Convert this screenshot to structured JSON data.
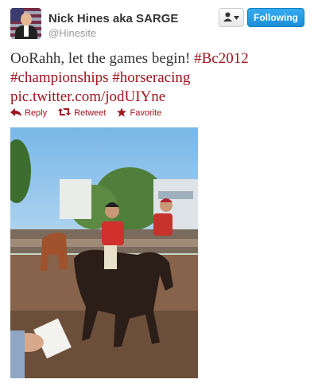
{
  "user": {
    "display_name": "Nick Hines aka SARGE",
    "handle": "@Hinesite"
  },
  "buttons": {
    "follow_label": "Following",
    "user_menu_icon": "user-dropdown-icon"
  },
  "tweet": {
    "text_parts": [
      "OoRahh, let the games begin! ",
      "#Bc2012",
      " ",
      "#championships",
      " ",
      "#horseracing",
      " ",
      "pic.twitter.com/jodUIYne"
    ]
  },
  "actions": {
    "reply": "Reply",
    "retweet": "Retweet",
    "favorite": "Favorite"
  },
  "colors": {
    "link": "#a0141e",
    "follow_button": "#1d8fd8"
  }
}
